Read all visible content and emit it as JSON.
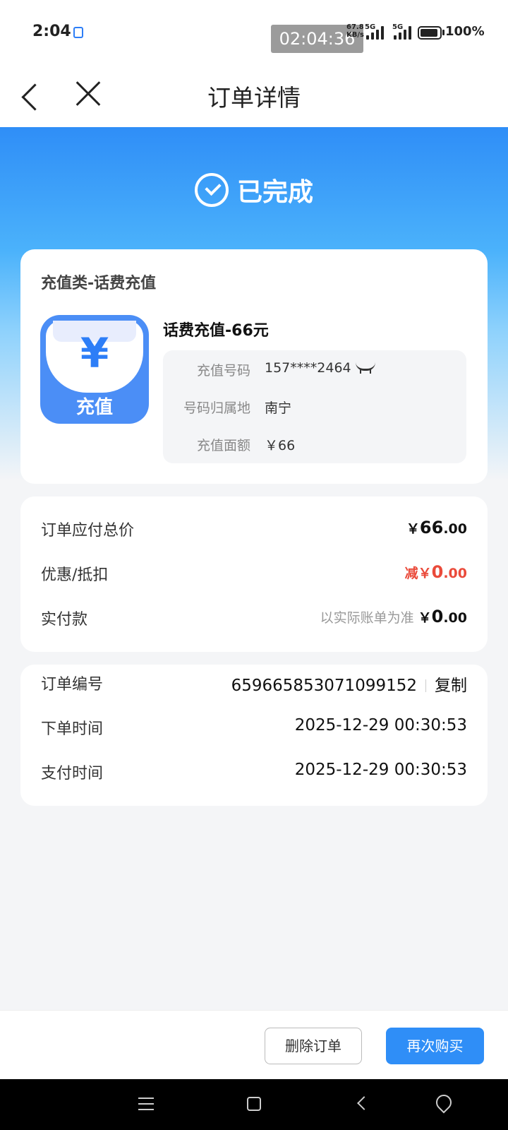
{
  "status_bar": {
    "time": "2:04",
    "timer": "02:04:36",
    "net_speed": "67.8\nKB/s",
    "net_1": "5G",
    "net_2": "5G",
    "battery": "100%"
  },
  "nav": {
    "back_icon": "chevron-left-icon",
    "close_icon": "close-icon",
    "title": "订单详情"
  },
  "hero": {
    "status_icon": "check-circle-icon",
    "status_text": "已完成"
  },
  "product": {
    "category": "充值类-话费充值",
    "icon_symbol": "¥",
    "icon_label": "充值",
    "name": "话费充值-66元",
    "details": [
      {
        "label": "充值号码",
        "value": "157****2464"
      },
      {
        "label": "号码归属地",
        "value": "南宁"
      },
      {
        "label": "充值面额",
        "value": "￥66"
      }
    ]
  },
  "payment": {
    "rows": [
      {
        "label": "订单应付总价",
        "prefix": "",
        "currency": "￥",
        "int": "66",
        "dec": ".00"
      },
      {
        "label": "优惠/抵扣",
        "prefix": "减",
        "currency": "￥",
        "int": "0",
        "dec": ".00"
      },
      {
        "label": "实付款",
        "note": "以实际账单为准",
        "currency": "￥",
        "int": "0",
        "dec": ".00"
      }
    ]
  },
  "order": {
    "rows": [
      {
        "label": "订单编号",
        "value": "659665853071099152",
        "action": "复制"
      },
      {
        "label": "下单时间",
        "value": "2025-12-29 00:30:53"
      },
      {
        "label": "支付时间",
        "value": "2025-12-29 00:30:53"
      }
    ]
  },
  "actions": {
    "delete": "删除订单",
    "buy_again": "再次购买"
  },
  "colors": {
    "accent": "#2f8ef7",
    "discount_red": "#ea4a3a"
  }
}
